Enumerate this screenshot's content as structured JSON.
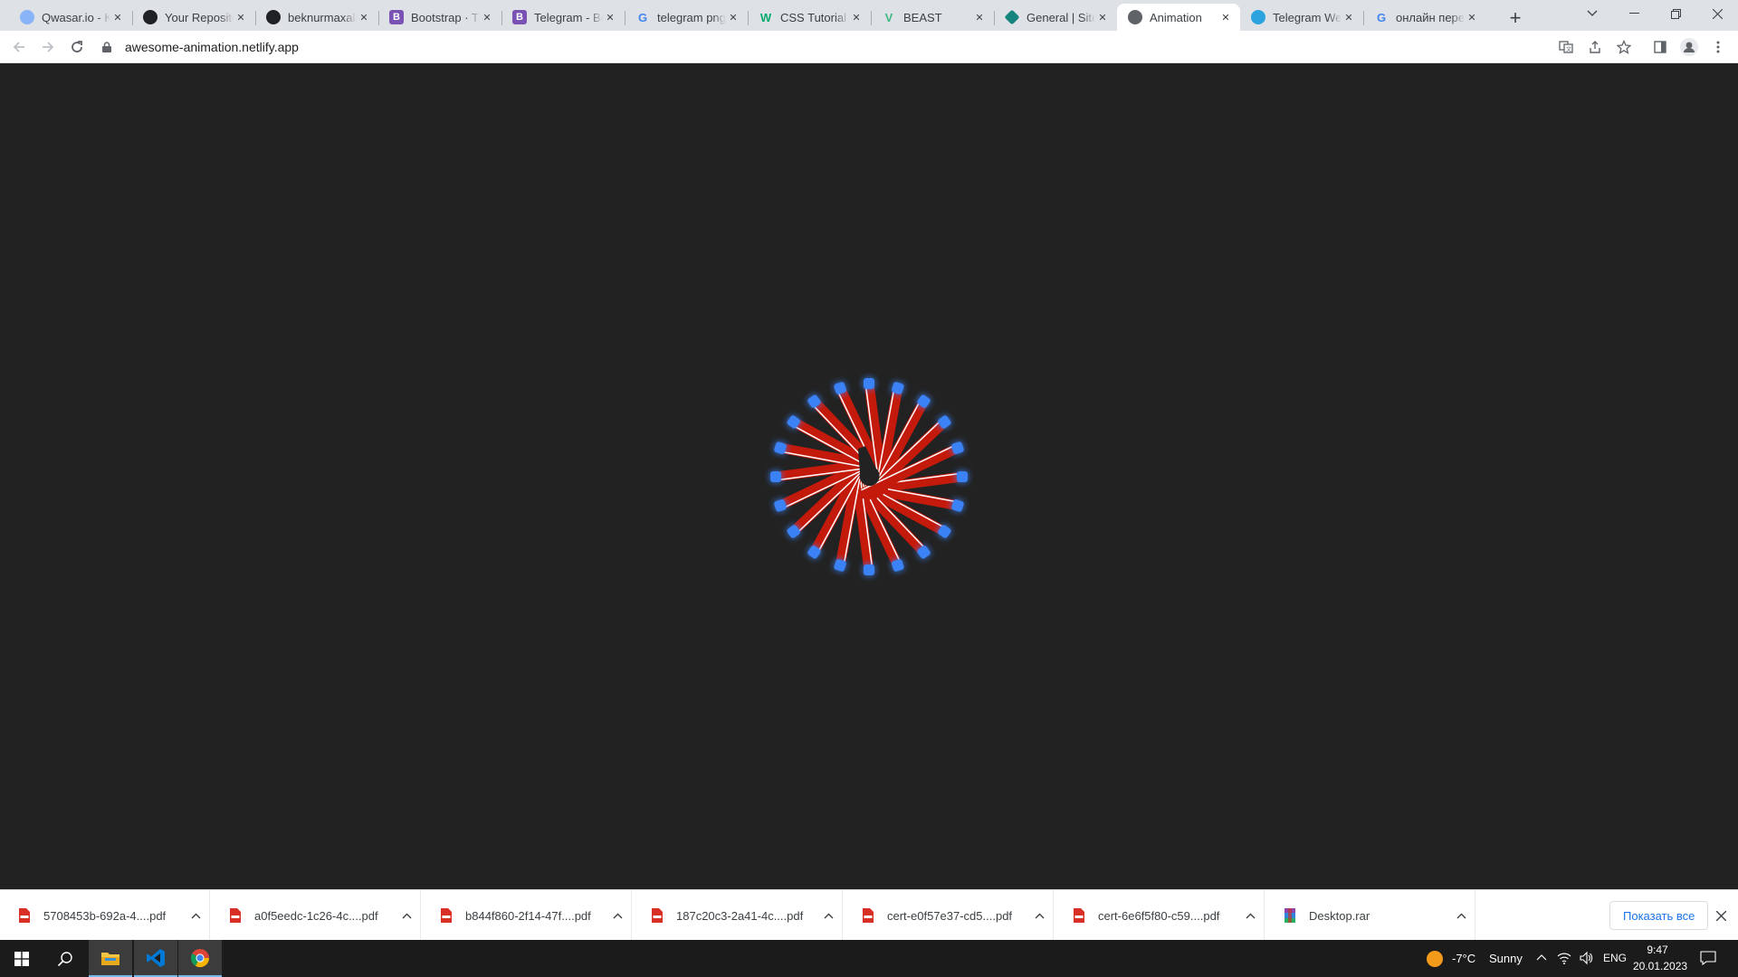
{
  "tabs": [
    {
      "title": "Qwasar.io - Kanban",
      "favicon": "qwasar-icon",
      "color": "#8ab4f8"
    },
    {
      "title": "Your Repositories",
      "favicon": "github-icon",
      "color": "#202124"
    },
    {
      "title": "beknurmaxallo",
      "favicon": "github-icon",
      "color": "#202124"
    },
    {
      "title": "Bootstrap · The",
      "favicon": "bootstrap-icon",
      "color": "#7952b3"
    },
    {
      "title": "Telegram - Bootstrap",
      "favicon": "bootstrap-icon",
      "color": "#7952b3"
    },
    {
      "title": "telegram png",
      "favicon": "google-icon",
      "color": "#4285f4"
    },
    {
      "title": "CSS Tutorial",
      "favicon": "w3schools-icon",
      "color": "#04aa6d"
    },
    {
      "title": "BEAST",
      "favicon": "vue-icon",
      "color": "#42b883"
    },
    {
      "title": "General | Site",
      "favicon": "netlify-icon",
      "color": "#15847d"
    },
    {
      "title": "Animation",
      "favicon": "globe-icon",
      "color": "#5f6368"
    },
    {
      "title": "Telegram Web",
      "favicon": "telegram-icon",
      "color": "#2aa3df"
    },
    {
      "title": "онлайн пере",
      "favicon": "google-icon",
      "color": "#4285f4"
    }
  ],
  "active_tab": 9,
  "address_bar": {
    "url": "awesome-animation.netlify.app"
  },
  "downloads": [
    {
      "name": "5708453b-692a-4....pdf",
      "icon": "pdf-icon"
    },
    {
      "name": "a0f5eedc-1c26-4c....pdf",
      "icon": "pdf-icon"
    },
    {
      "name": "b844f860-2f14-47f....pdf",
      "icon": "pdf-icon"
    },
    {
      "name": "187c20c3-2a41-4c....pdf",
      "icon": "pdf-icon"
    },
    {
      "name": "cert-e0f57e37-cd5....pdf",
      "icon": "pdf-icon"
    },
    {
      "name": "cert-6e6f5f80-c59....pdf",
      "icon": "pdf-icon"
    },
    {
      "name": "Desktop.rar",
      "icon": "rar-icon"
    }
  ],
  "show_all_label": "Показать все",
  "taskbar": {
    "weather_temp": "-7°C",
    "weather_text": "Sunny",
    "language": "ENG",
    "time": "9:47",
    "date": "20.01.2023"
  },
  "animation": {
    "stick_count": 20,
    "stick_color": "#c41a0c",
    "tip_color": "#3b82f6",
    "glow_color": "#4a90e2"
  }
}
